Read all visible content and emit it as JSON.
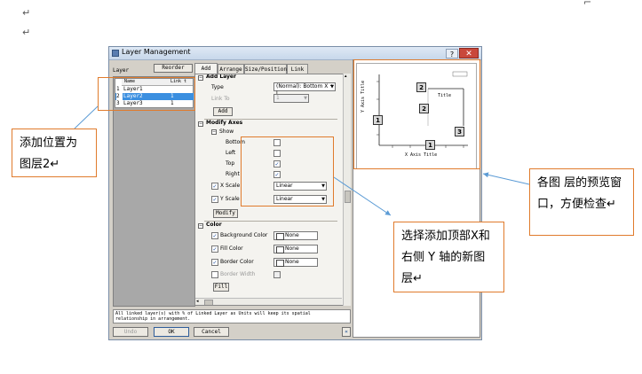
{
  "doc": {
    "return_mark": "↵"
  },
  "dialog": {
    "title": "Layer Management",
    "help": "?",
    "close": "✕",
    "layer_label": "Layer",
    "reorder_button": "Reorder",
    "layer_table": {
      "headers": [
        "Name",
        "Link t"
      ],
      "rows": [
        {
          "num": "1",
          "name": "Layer1",
          "link": ""
        },
        {
          "num": "2",
          "name": "Layer2",
          "link": "1"
        },
        {
          "num": "3",
          "name": "Layer3",
          "link": "1"
        }
      ],
      "selected_row": 2
    },
    "tabs": [
      "Add",
      "Arrange",
      "Size/Position",
      "Link"
    ],
    "active_tab": "Add",
    "add_layer": {
      "section": "Add Layer",
      "type_label": "Type",
      "type_value": "(Normal): Bottom X + L",
      "link_to_label": "Link To",
      "link_to_value": "1",
      "add_button": "Add"
    },
    "modify_axes": {
      "section": "Modify Axes",
      "show_label": "Show",
      "show_items": [
        {
          "label": "Bottom",
          "checked": false
        },
        {
          "label": "Left",
          "checked": false
        },
        {
          "label": "Top",
          "checked": true
        },
        {
          "label": "Right",
          "checked": true
        }
      ],
      "x_scale_label": "X Scale",
      "x_scale_value": "Linear",
      "y_scale_label": "Y Scale",
      "y_scale_value": "Linear",
      "modify_button": "Modify"
    },
    "color": {
      "section": "Color",
      "items": [
        {
          "label": "Background Color",
          "value": "None"
        },
        {
          "label": "Fill Color",
          "value": "None"
        },
        {
          "label": "Border Color",
          "value": "None"
        }
      ],
      "border_width_label": "Border Width",
      "fill_button": "Fill"
    },
    "status_text_1": "All linked layer(s) with % of Linked Layer as Units will keep its spatial",
    "status_text_2": "relationship in arrangement.",
    "buttons": {
      "undo": "Undo",
      "ok": "OK",
      "cancel": "Cancel",
      "collapse": "«"
    },
    "preview": {
      "layers": [
        "1",
        "2",
        "2",
        "1",
        "3"
      ],
      "y_axis_title": "Y Axis Title",
      "x_axis_title": "X Axis Title",
      "top_axis_title": "Title"
    }
  },
  "callouts": {
    "add_position": "添加位置为 图层2↵",
    "preview_note": "各图 层的预览窗口，方便检查↵",
    "new_layer_note": "选择添加顶部X和右侧 Y 轴的新图层↵"
  },
  "colors": {
    "accent": "#e07b2c",
    "selection": "#3b8fe0",
    "arrow": "#5b9bd5"
  }
}
